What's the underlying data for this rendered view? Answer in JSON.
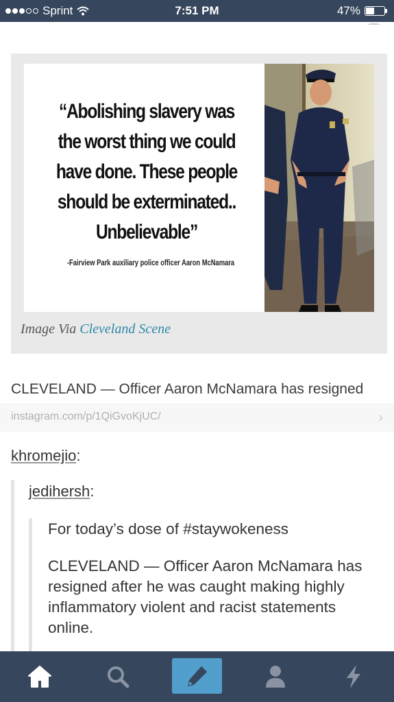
{
  "status_bar": {
    "carrier": "Sprint",
    "time": "7:51 PM",
    "battery": "47%",
    "battery_level": 0.47,
    "signal_bars": 3,
    "signal_total": 5
  },
  "post": {
    "image": {
      "quote": "“Abolishing slavery was the worst thing we could have done. These people should be exterminated.. Unbelievable”",
      "attribution": "-Fairview Park auxiliary police officer Aaron McNamara"
    },
    "caption_prefix": "Image Via ",
    "caption_link": "Cleveland Scene",
    "link_title": "CLEVELAND — Officer Aaron McNamara has resigned",
    "link_url": "instagram.com/p/1QiGvoKjUC/",
    "reblogger": "khromejio",
    "original_poster": "jedihersh",
    "body": [
      "For today’s dose of #staywokeness",
      "CLEVELAND — Officer Aaron McNamara has resigned after he was caught making highly inflammatory violent and racist statements online."
    ]
  },
  "tabs": [
    "home-icon",
    "search-icon",
    "compose-icon",
    "account-icon",
    "activity-icon"
  ],
  "colors": {
    "nav_bg": "#36465d",
    "compose_accent": "#529ecc",
    "link": "#2f88a8",
    "inactive_icon": "#8993a2"
  }
}
